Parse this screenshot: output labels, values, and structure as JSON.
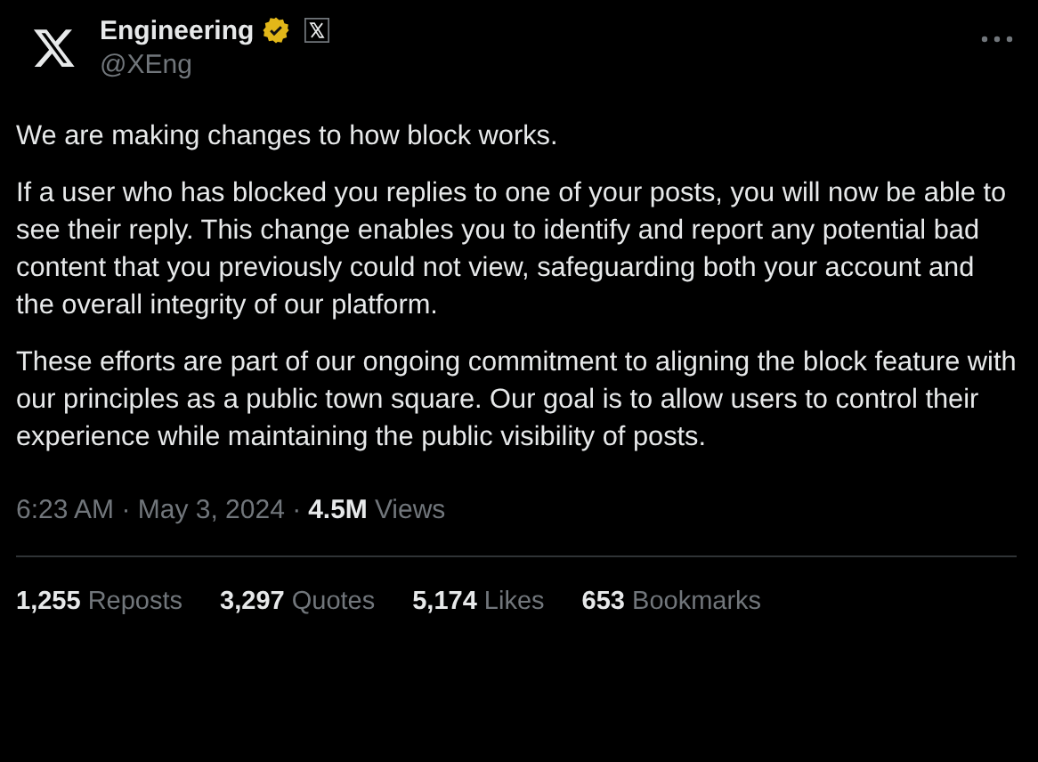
{
  "author": {
    "name": "Engineering",
    "handle": "@XEng",
    "verified": true
  },
  "paragraphs": [
    "We are making changes to how block works.",
    "If a user who has blocked you replies to one of your posts, you will now be able to see their reply. This change enables you to identify and report any potential bad content that you previously could not view, safeguarding both your account and the overall integrity of our platform.",
    "These efforts are part of our ongoing commitment to aligning the block feature with our principles as a public town square. Our goal is to allow users to control their experience while maintaining the public visibility of posts."
  ],
  "meta": {
    "time": "6:23 AM · May 3, 2024 ·",
    "views_count": "4.5M",
    "views_label": "Views"
  },
  "stats": [
    "**1,255** Reposts",
    "**3,297** Quotes",
    "**5,174** Likes",
    "**653** Bookmarks"
  ]
}
